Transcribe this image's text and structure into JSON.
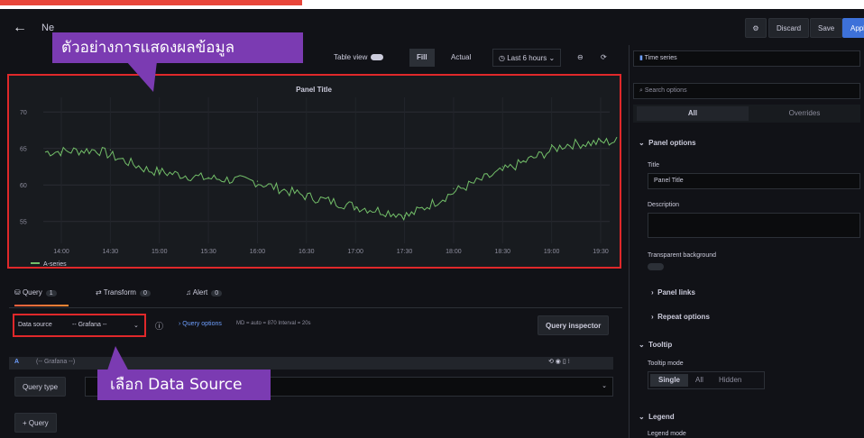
{
  "header": {
    "title": "Ne",
    "discard": "Discard",
    "save": "Save",
    "apply": "Appl"
  },
  "toolbar": {
    "table_view": "Table view",
    "fill": "Fill",
    "actual": "Actual",
    "time_range": "Last 6 hours"
  },
  "chart_data": {
    "type": "line",
    "title": "Panel Title",
    "x": [
      "14:00",
      "14:30",
      "15:00",
      "15:30",
      "16:00",
      "16:30",
      "17:00",
      "17:30",
      "18:00",
      "18:30",
      "19:00",
      "19:30"
    ],
    "series": [
      {
        "name": "A-series",
        "color": "#73bf69",
        "values": [
          64.5,
          64.8,
          62,
          61,
          60.5,
          58.5,
          57,
          55.8,
          59.5,
          62.5,
          65.5,
          66
        ]
      }
    ],
    "y_ticks": [
      "70",
      "65",
      "60",
      "55"
    ],
    "ylim": [
      52,
      72
    ],
    "grid": true,
    "legend": "bottom-left"
  },
  "query_tabs": [
    {
      "label": "Query",
      "count": "1"
    },
    {
      "label": "Transform",
      "count": "0"
    },
    {
      "label": "Alert",
      "count": "0"
    }
  ],
  "datasource": {
    "label": "Data source",
    "value": "-- Grafana --",
    "options_label": "Query options",
    "options_detail": "MD = auto = 870   Interval = 20s",
    "inspector": "Query inspector"
  },
  "query": {
    "letter": "A",
    "source": "(-- Grafana --)",
    "type_label": "Query type",
    "add": "+ Query"
  },
  "right": {
    "viz": "Time series",
    "search_placeholder": "Search options",
    "tab_all": "All",
    "tab_overrides": "Overrides",
    "panel_options": "Panel options",
    "title_label": "Title",
    "title_value": "Panel Title",
    "description": "Description",
    "transparent": "Transparent background",
    "panel_links": "Panel links",
    "repeat_options": "Repeat options",
    "tooltip": "Tooltip",
    "tooltip_mode": "Tooltip mode",
    "mode_single": "Single",
    "mode_all": "All",
    "mode_hidden": "Hidden",
    "legend": "Legend",
    "legend_mode": "Legend mode"
  },
  "callouts": {
    "top": "ตัวอย่างการแสดงผลข้อมูล",
    "bottom": "เลือก Data Source"
  }
}
